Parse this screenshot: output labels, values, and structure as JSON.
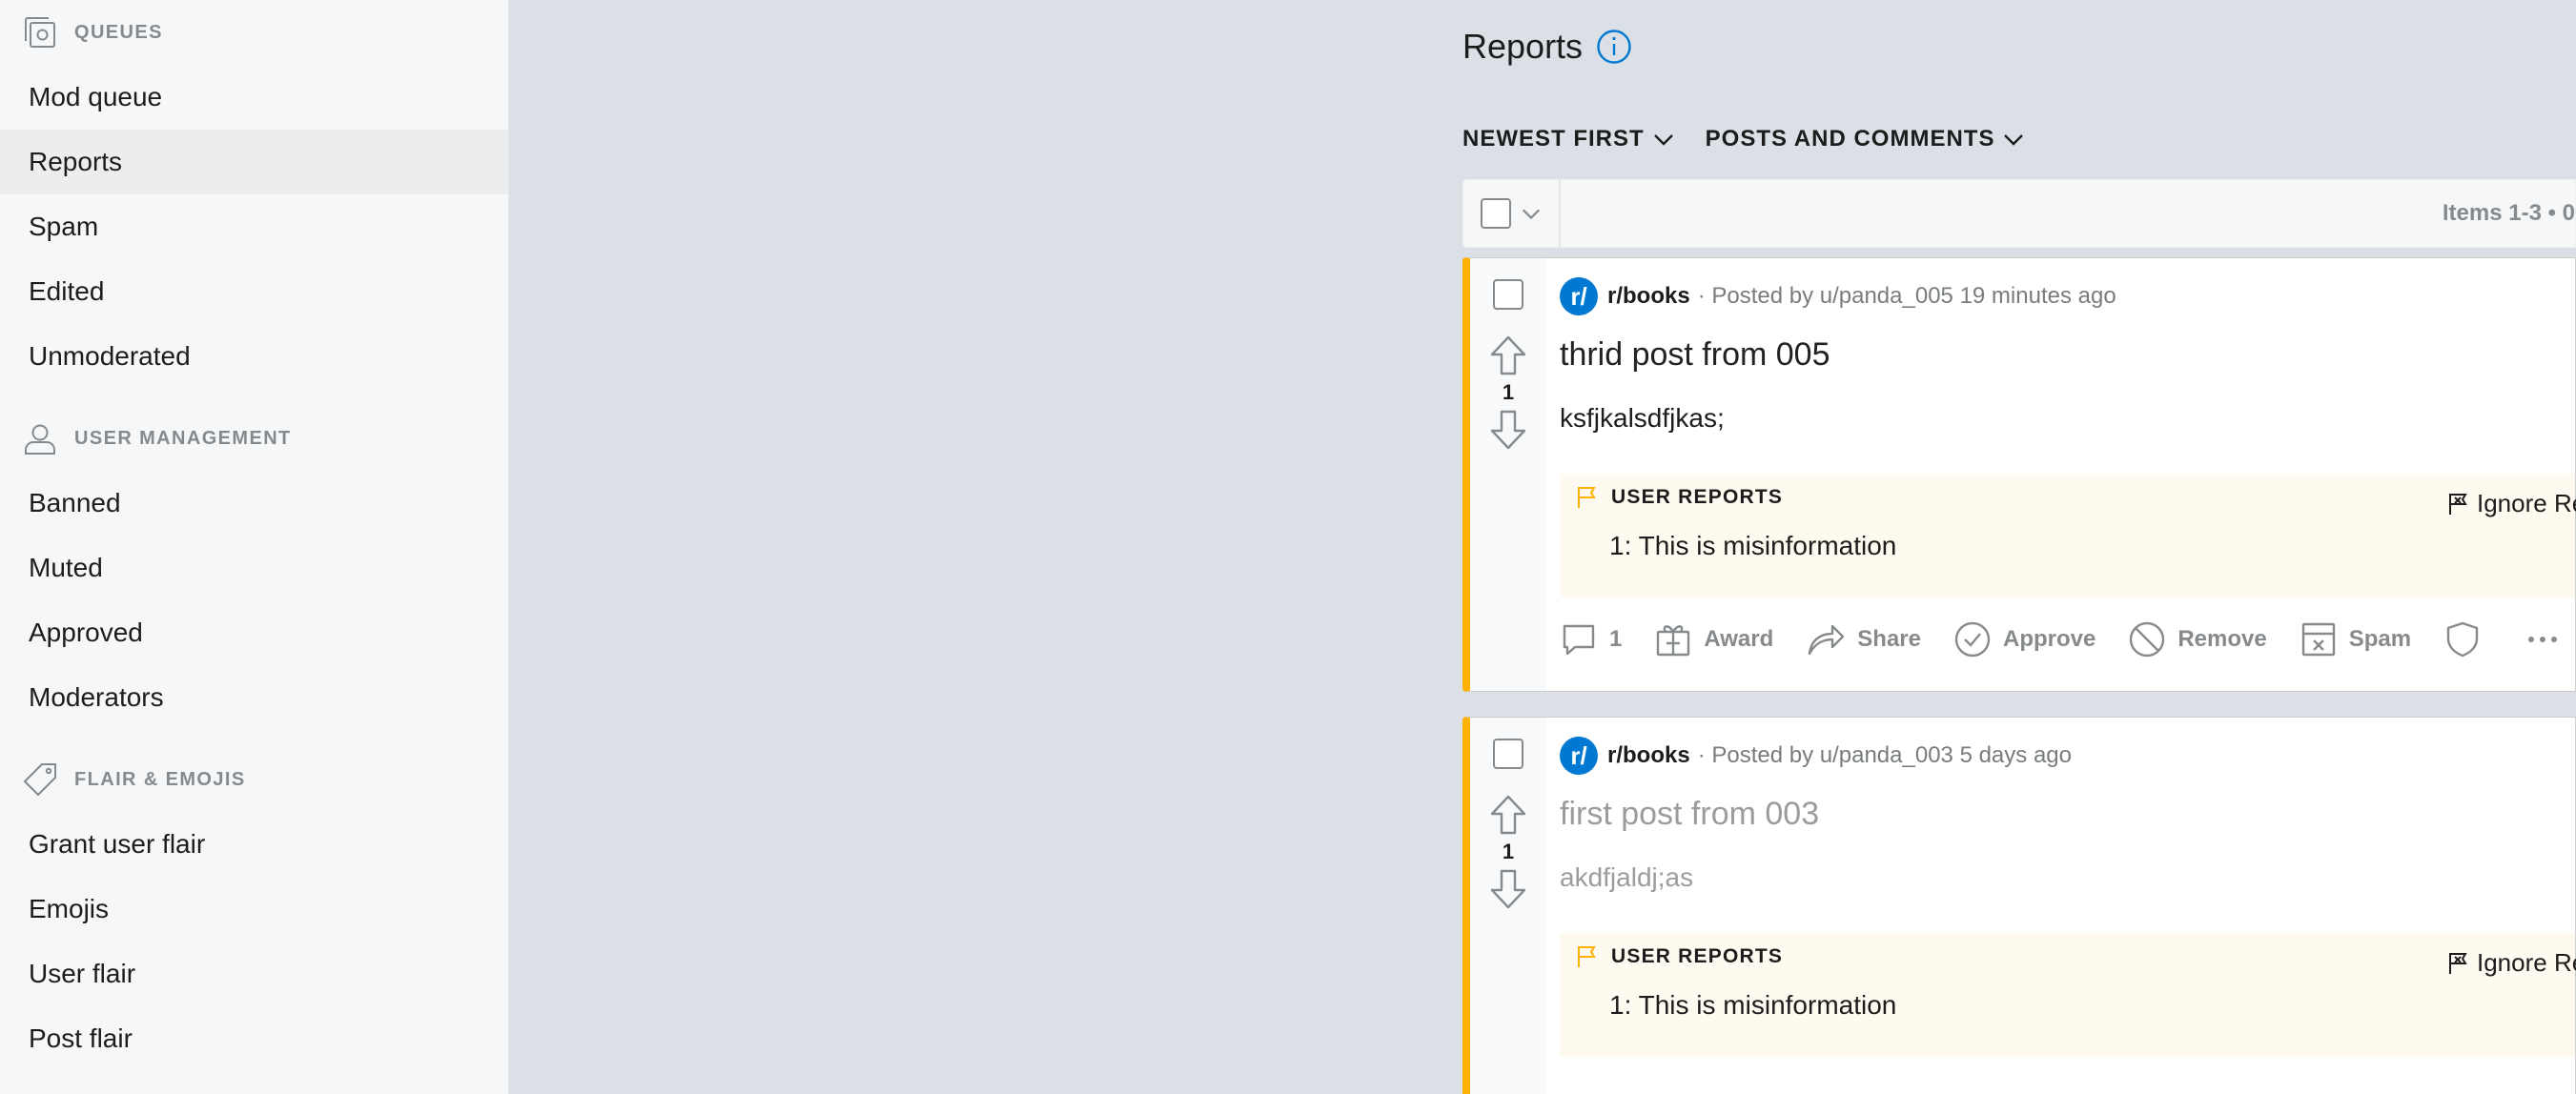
{
  "sidebar": {
    "sections": [
      {
        "title": "QUEUES",
        "items": [
          {
            "label": "Mod queue",
            "active": false
          },
          {
            "label": "Reports",
            "active": true
          },
          {
            "label": "Spam",
            "active": false
          },
          {
            "label": "Edited",
            "active": false
          },
          {
            "label": "Unmoderated",
            "active": false
          }
        ]
      },
      {
        "title": "USER MANAGEMENT",
        "items": [
          {
            "label": "Banned"
          },
          {
            "label": "Muted"
          },
          {
            "label": "Approved"
          },
          {
            "label": "Moderators"
          }
        ]
      },
      {
        "title": "FLAIR & EMOJIS",
        "items": [
          {
            "label": "Grant user flair"
          },
          {
            "label": "Emojis"
          },
          {
            "label": "User flair"
          },
          {
            "label": "Post flair"
          }
        ]
      }
    ]
  },
  "main": {
    "title": "Reports",
    "filters": {
      "sort": "NEWEST FIRST",
      "type": "POSTS AND COMMENTS"
    },
    "bulkbar": {
      "items_count": "Items 1-3  •  0"
    },
    "posts": [
      {
        "subreddit": "r/books",
        "posted": "· Posted by u/panda_005 19 minutes ago",
        "score": "1",
        "title": "thrid post from 005",
        "text": "ksfjkalsdfjkas;",
        "reports_label": "USER REPORTS",
        "report_line": "1: This is misinformation",
        "ignore_label": "Ignore Re",
        "actions": {
          "comments": "1",
          "award": "Award",
          "share": "Share",
          "approve": "Approve",
          "remove": "Remove",
          "spam": "Spam"
        }
      },
      {
        "subreddit": "r/books",
        "posted": "· Posted by u/panda_003 5 days ago",
        "score": "1",
        "title": "first post from 003",
        "text": "akdfjaldj;as",
        "reports_label": "USER REPORTS",
        "report_line": "1: This is misinformation",
        "ignore_label": "Ignore Re"
      }
    ]
  },
  "colors": {
    "accent": "#0079d3",
    "report_bar": "#ffb000",
    "background": "#dae0e6"
  }
}
